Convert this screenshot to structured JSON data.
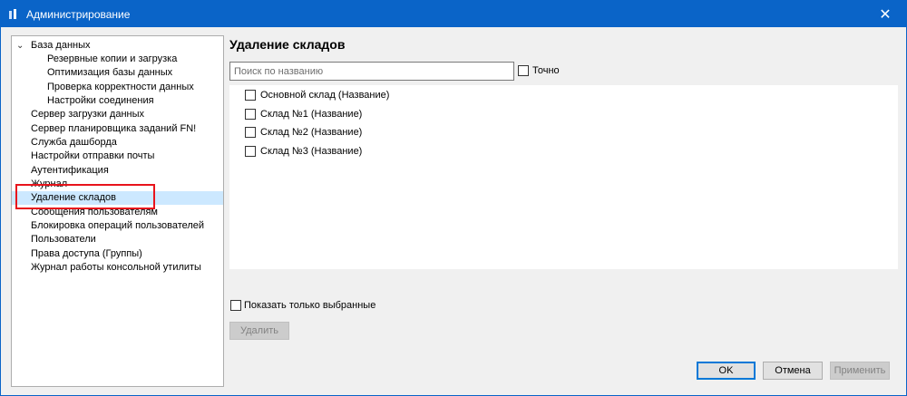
{
  "window": {
    "title": "Администрирование",
    "close_glyph": "✕",
    "accent": "#0a64c8"
  },
  "tree": {
    "items": [
      {
        "label": "База данных"
      },
      {
        "label": "Резервные копии и загрузка"
      },
      {
        "label": "Оптимизация базы данных"
      },
      {
        "label": "Проверка корректности данных"
      },
      {
        "label": "Настройки соединения"
      },
      {
        "label": "Сервер загрузки данных"
      },
      {
        "label": "Сервер планировщика заданий FN!"
      },
      {
        "label": "Служба дашборда"
      },
      {
        "label": "Настройки отправки почты"
      },
      {
        "label": "Аутентификация"
      },
      {
        "label": "Журнал"
      },
      {
        "label": "Удаление складов"
      },
      {
        "label": "Сообщения пользователям"
      },
      {
        "label": "Блокировка операций пользователей"
      },
      {
        "label": "Пользователи"
      },
      {
        "label": "Права доступа (Группы)"
      },
      {
        "label": "Журнал работы консольной утилиты"
      }
    ],
    "selected_label": "Удаление складов",
    "expand_glyph": "⌄",
    "highlight_color": "#e8141c",
    "selection_color": "#cce8ff"
  },
  "main": {
    "title": "Удаление складов",
    "search": {
      "placeholder": "Поиск по названию",
      "value": ""
    },
    "exact_label": "Точно",
    "warehouses": [
      {
        "label": "Основной склад (Название)",
        "checked": false
      },
      {
        "label": "Склад №1 (Название)",
        "checked": false
      },
      {
        "label": "Склад №2 (Название)",
        "checked": false
      },
      {
        "label": "Склад №3 (Название)",
        "checked": false
      }
    ],
    "show_selected_label": "Показать только выбранные",
    "delete_label": "Удалить"
  },
  "footer": {
    "ok_label": "OK",
    "cancel_label": "Отмена",
    "apply_label": "Применить"
  }
}
